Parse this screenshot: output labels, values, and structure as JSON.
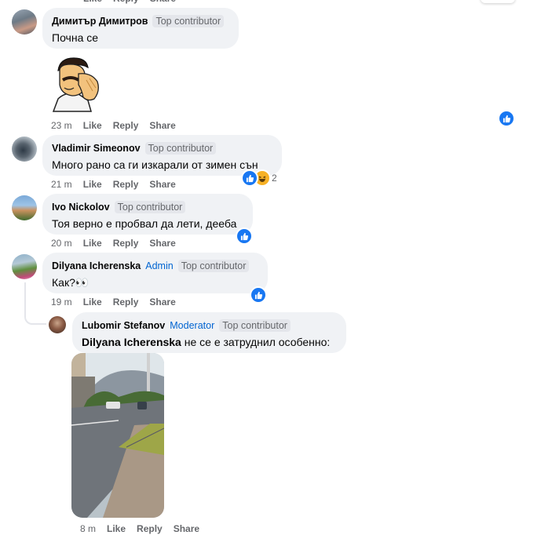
{
  "comments": [
    {
      "author": "Димитър Димитров",
      "badge": "Top contributor",
      "text": "Почна се",
      "time": "23 m",
      "like": "Like",
      "reply": "Reply",
      "share": "Share"
    },
    {
      "author": "Vladimir Simeonov",
      "badge": "Top contributor",
      "text": "Много рано са ги изкарали от зимен сън",
      "time": "21 m",
      "like": "Like",
      "reply": "Reply",
      "share": "Share",
      "reaction_count": "2"
    },
    {
      "author": "Ivo Nickolov",
      "badge": "Top contributor",
      "text": "Тоя верно е пробвал да лети, дееба",
      "time": "20 m",
      "like": "Like",
      "reply": "Reply",
      "share": "Share"
    },
    {
      "author": "Dilyana Icherenska",
      "role": "Admin",
      "badge": "Top contributor",
      "text": "Как?👀",
      "time": "19 m",
      "like": "Like",
      "reply": "Reply",
      "share": "Share"
    },
    {
      "author": "Lubomir Stefanov",
      "role": "Moderator",
      "badge": "Top contributor",
      "mention": "Dilyana Icherenska",
      "text": " не се е затруднил особенно:"
    }
  ],
  "colors": {
    "bubble": "#f0f2f5",
    "like_blue": "#1877f2",
    "admin_blue": "#0064d1",
    "muted": "#65676b"
  }
}
